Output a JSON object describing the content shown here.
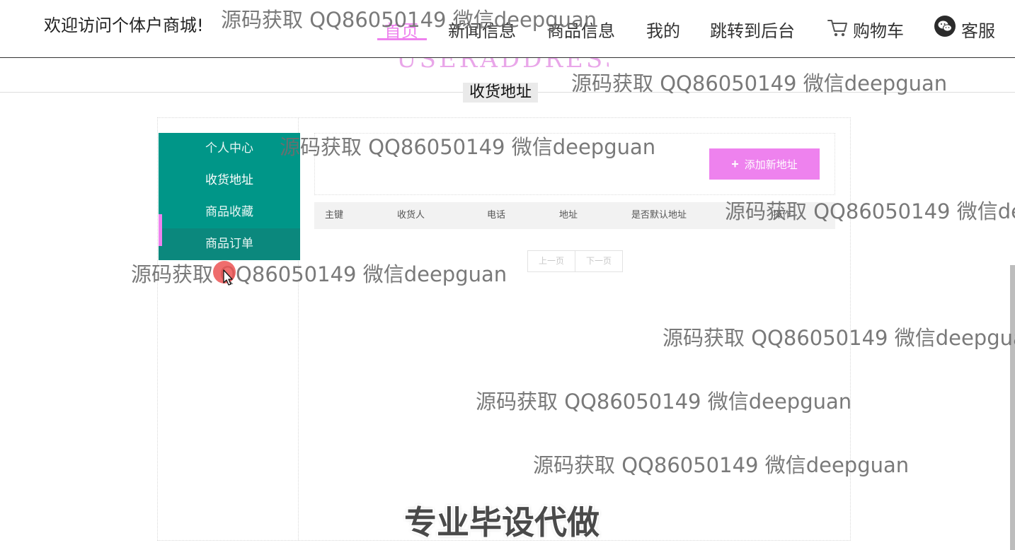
{
  "header": {
    "welcome": "欢迎访问个体户商城!",
    "nav": {
      "home": "首页",
      "news": "新闻信息",
      "goods": "商品信息",
      "mine": "我的",
      "admin": "跳转到后台",
      "cart": "购物车",
      "service": "客服"
    }
  },
  "band": {
    "deco_text": "USERADDRESS",
    "title": "收货地址"
  },
  "sidebar": {
    "items": [
      "个人中心",
      "收货地址",
      "商品收藏",
      "商品订单"
    ]
  },
  "toolbar": {
    "add_label": "添加新地址"
  },
  "table": {
    "columns": [
      "主键",
      "收货人",
      "电话",
      "地址",
      "是否默认地址",
      "操作"
    ]
  },
  "pager": {
    "prev": "上一页",
    "next": "下一页"
  },
  "watermark": "源码获取 QQ86050149 微信deepguan",
  "promo": "专业毕设代做",
  "colors": {
    "accent": "#ee82ee",
    "sidebar": "#009688"
  }
}
